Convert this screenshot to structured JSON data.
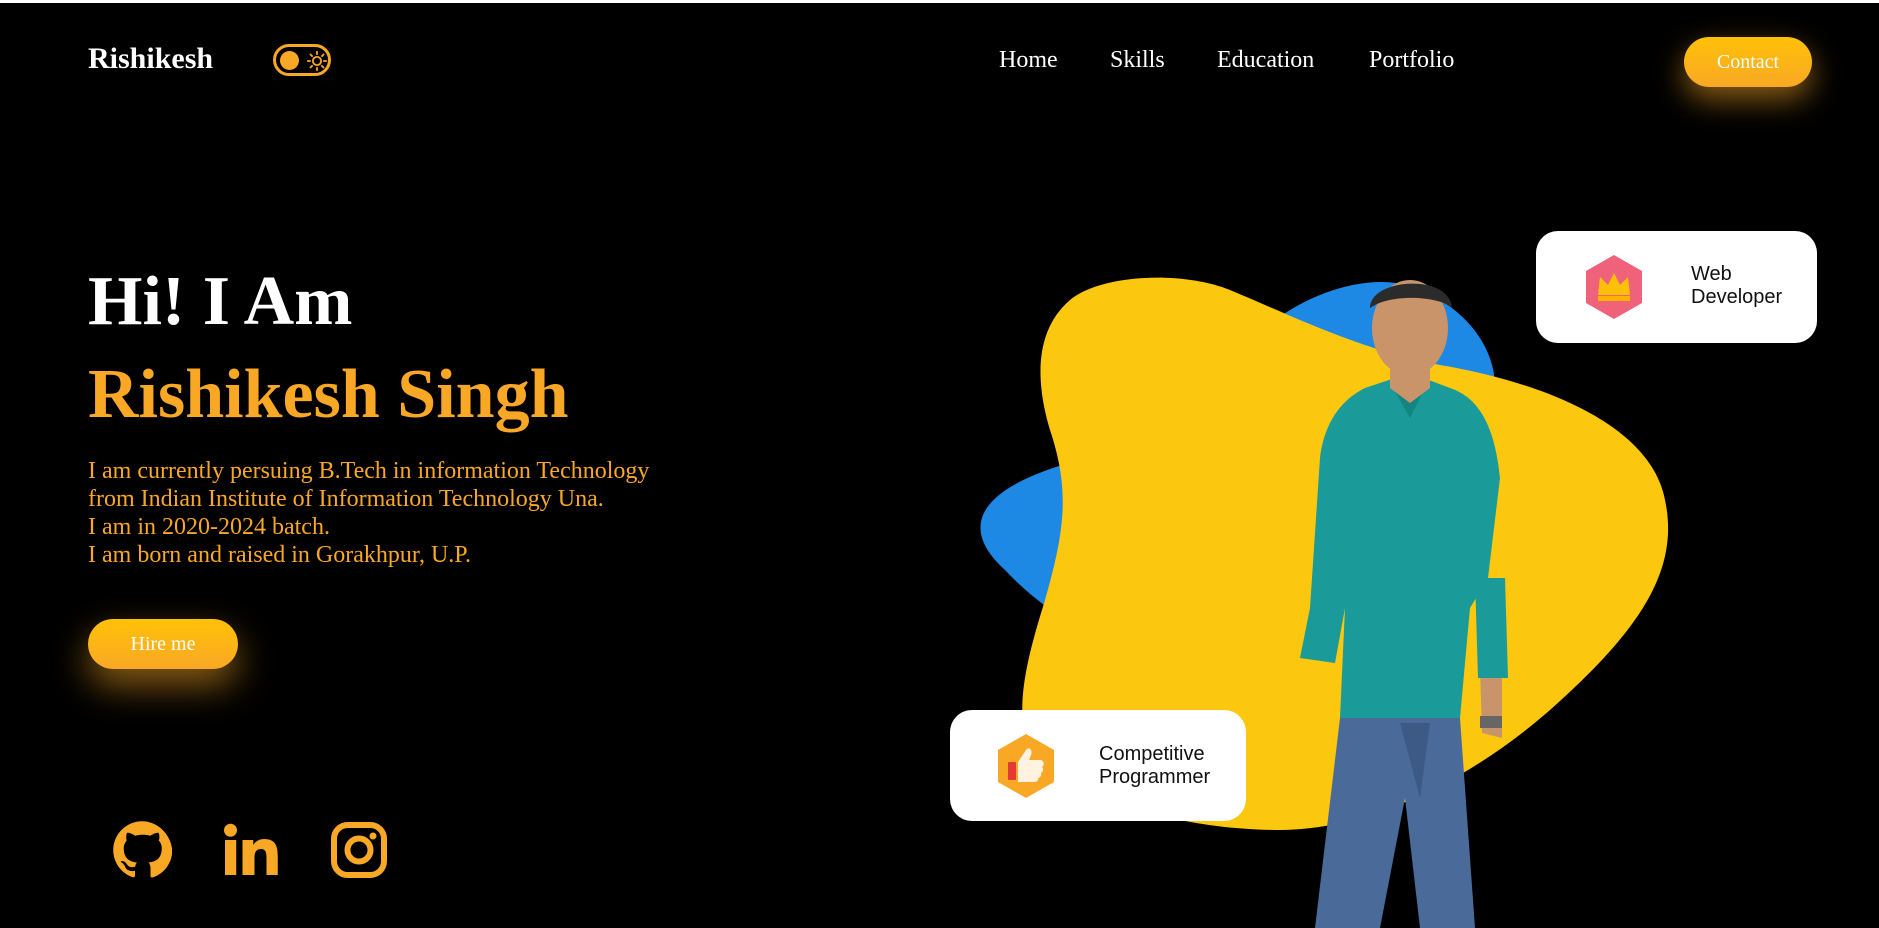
{
  "header": {
    "brand": "Rishikesh",
    "nav": [
      "Home",
      "Skills",
      "Education",
      "Portfolio"
    ],
    "contact_label": "Contact"
  },
  "hero": {
    "greeting": "Hi! I Am",
    "name": "Rishikesh Singh",
    "bio": [
      "I am currently persuing B.Tech in information Technology",
      "from Indian Institute of Information Technology Una.",
      "I am in 2020-2024 batch.",
      "I am born and raised in Gorakhpur, U.P."
    ],
    "hire_label": "Hire me"
  },
  "cards": {
    "web": "Web\nDeveloper",
    "cp": "Competitive\nProgrammer"
  },
  "social": {
    "icons": [
      "github-icon",
      "linkedin-icon",
      "instagram-icon"
    ]
  },
  "colors": {
    "accent": "#f9a825",
    "blob_yellow": "#fcc70f",
    "blob_blue": "#1e88e5",
    "background": "#000000"
  }
}
